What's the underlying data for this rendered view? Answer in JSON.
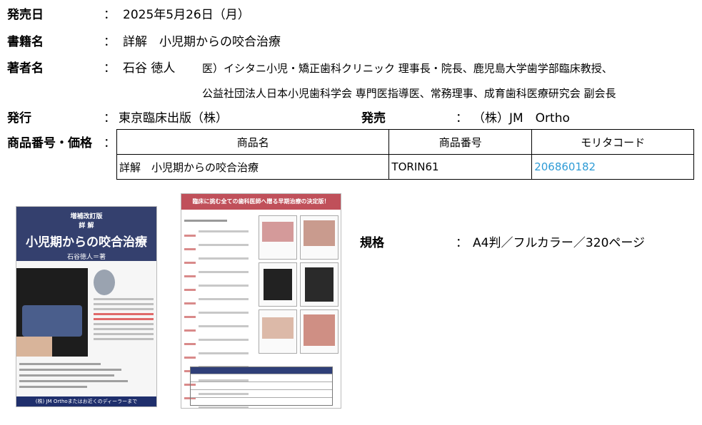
{
  "rows": {
    "release_date": {
      "label": "発売日",
      "value": "2025年5月26日（月）"
    },
    "book_title": {
      "label": "書籍名",
      "value": "詳解　小児期からの咬合治療"
    },
    "author": {
      "label": "著者名",
      "name": "石谷 徳人",
      "line1": "医）イシタニ小児・矯正歯科クリニック 理事長・院長、鹿児島大学歯学部臨床教授、",
      "line2": "公益社団法人日本小児歯科学会 専門医指導医、常務理事、成育歯科医療研究会 副会長"
    },
    "publisher": {
      "label": "発行",
      "value": "東京臨床出版（株）"
    },
    "seller": {
      "label": "発売",
      "value": "（株）JM　Ortho"
    },
    "product": {
      "label": "商品番号・価格"
    },
    "spec": {
      "label": "規格",
      "value": "A4判／フルカラー／320ページ"
    }
  },
  "colon": "：",
  "table": {
    "headers": [
      "商品名",
      "商品番号",
      "モリタコード"
    ],
    "row": [
      "詳解　小児期からの咬合治療",
      "TORIN61",
      "206860182"
    ]
  },
  "cover": {
    "edition": "増補改訂版",
    "subtitle": "詳 解",
    "title": "小児期からの咬合治療",
    "author": "石谷徳人＝著",
    "footer": "(株) JM Orthoまたはお近くのディーラーまで"
  },
  "flyer": {
    "header": "臨床に挑む全ての歯科医師へ贈る早期治療の決定版！"
  },
  "colors": {
    "link": "#2e9bd6",
    "cover_band": "#34406e",
    "flyer_band": "#c0505a"
  }
}
